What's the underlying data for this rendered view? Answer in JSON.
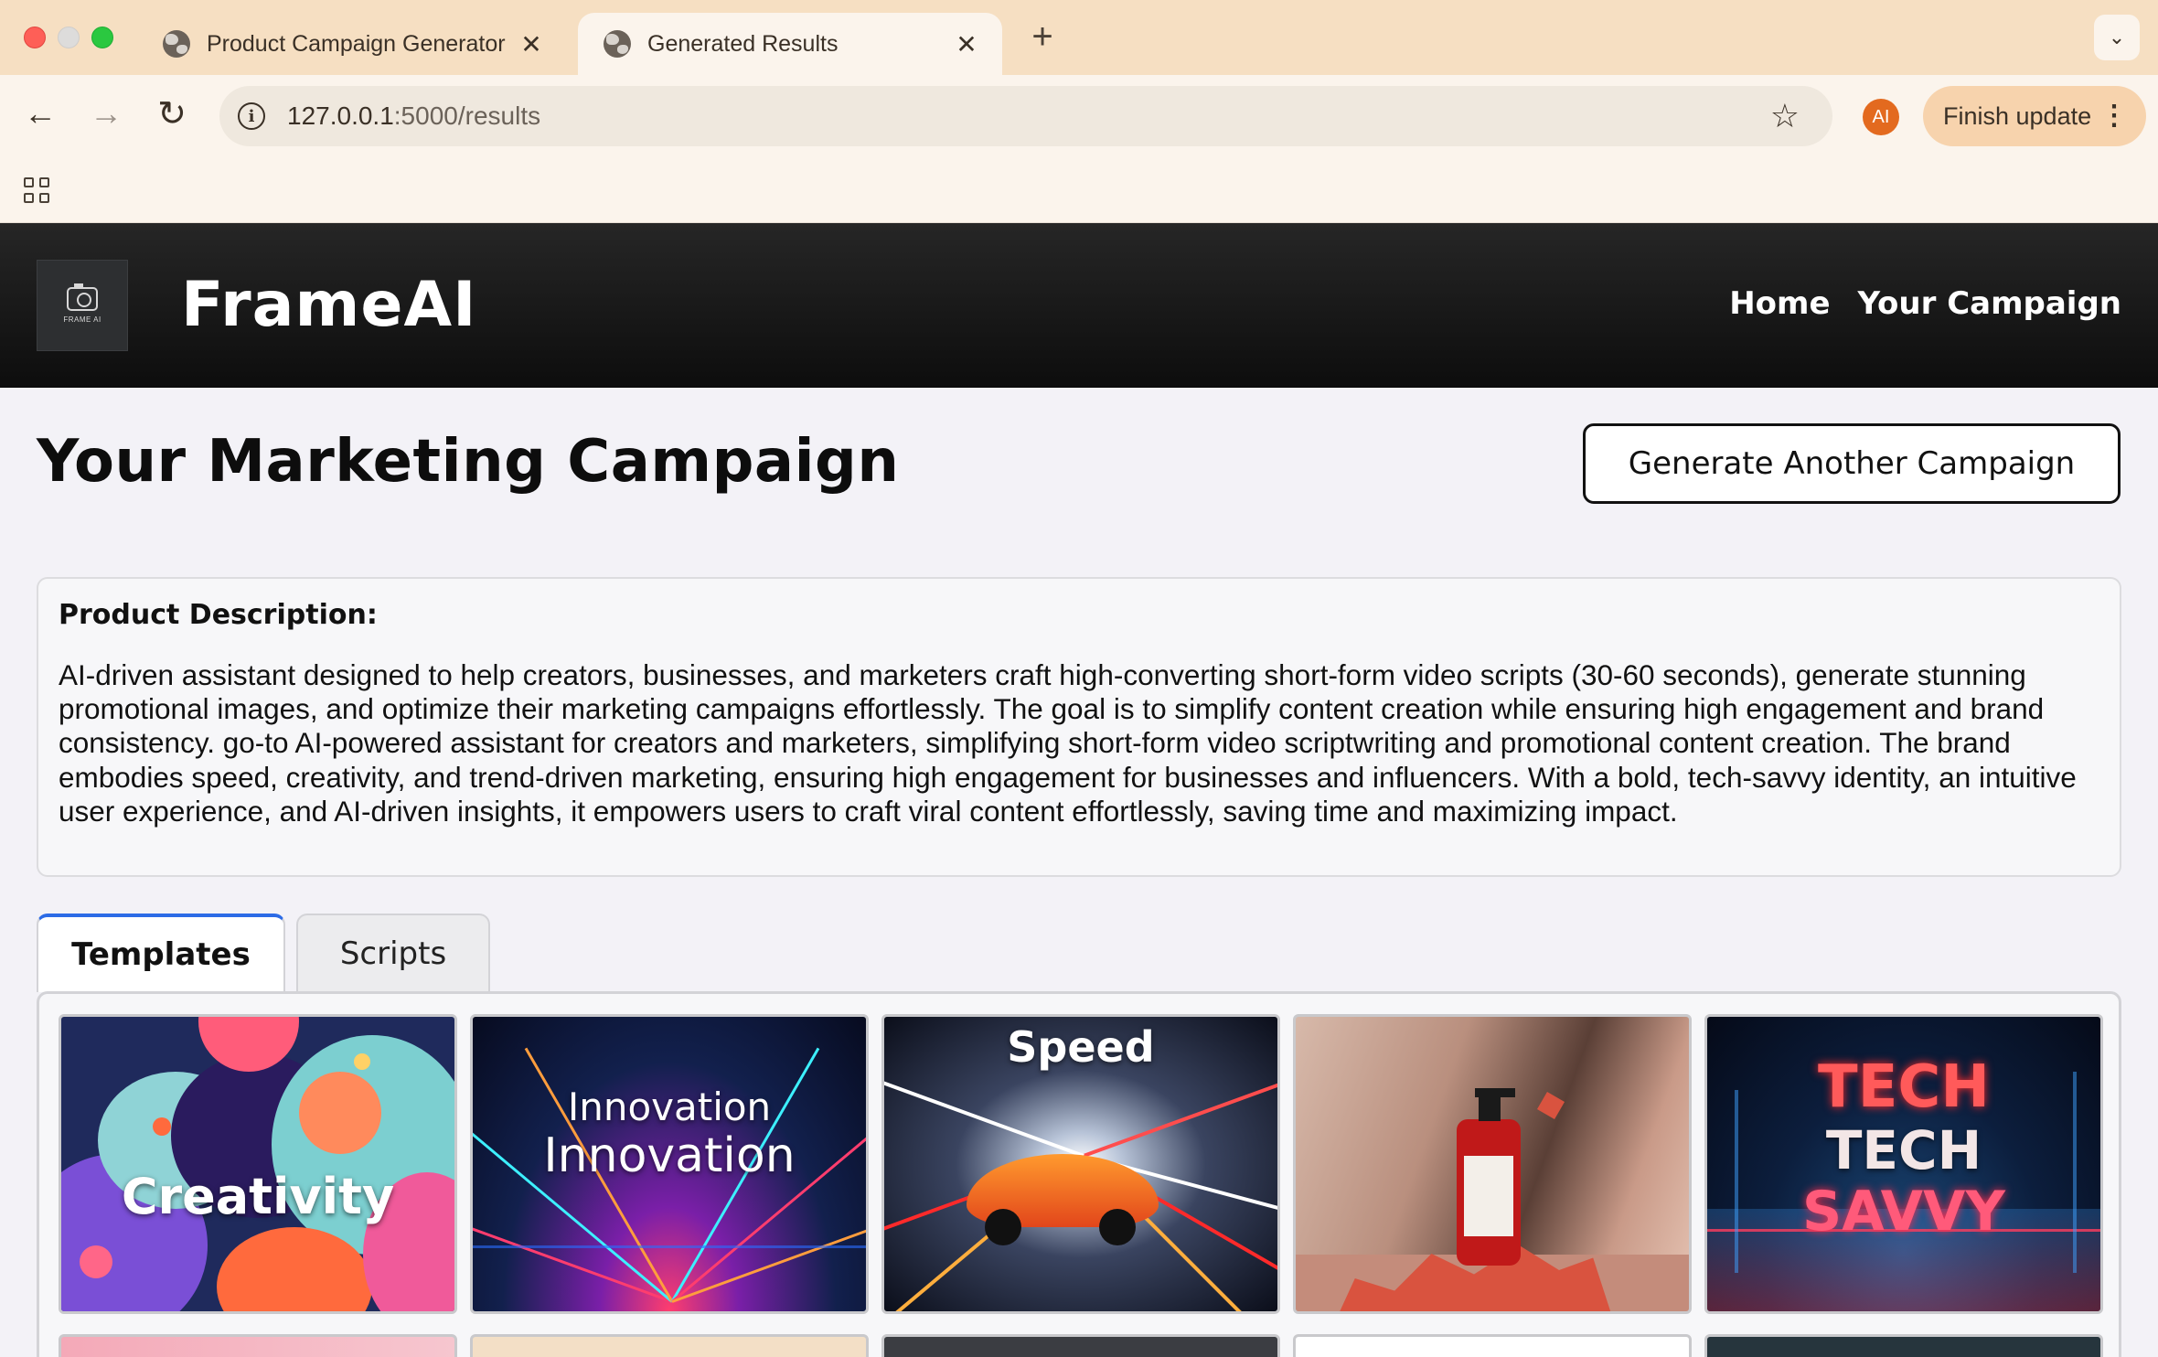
{
  "browser": {
    "tabs": [
      {
        "title": "Product Campaign Generator",
        "active": false
      },
      {
        "title": "Generated Results",
        "active": true
      }
    ],
    "close_glyph": "✕",
    "new_tab_glyph": "+",
    "tab_menu_glyph": "⌄",
    "url_host": "127.0.0.1",
    "url_path": ":5000/results",
    "profile_initials": "AI",
    "finish_update_label": "Finish update",
    "icons": {
      "back": "←",
      "forward": "→",
      "reload": "↻",
      "star": "☆",
      "info": "i",
      "kebab": "⋮"
    }
  },
  "site": {
    "logo_text": "FRAME AI",
    "brand": "FrameAI",
    "nav": [
      "Home",
      "Your Campaign"
    ]
  },
  "page": {
    "title": "Your Marketing Campaign",
    "generate_button": "Generate Another Campaign",
    "description_heading": "Product Description:",
    "description_text": "AI-driven assistant designed to help creators, businesses, and marketers craft high-converting short-form video scripts (30-60 seconds), generate stunning promotional images, and optimize their marketing campaigns effortlessly. The goal is to simplify content creation while ensuring high engagement and brand consistency. go-to AI-powered assistant for creators and marketers, simplifying short-form video scriptwriting and promotional content creation. The brand embodies speed, creativity, and trend-driven marketing, ensuring high engagement for businesses and influencers. With a bold, tech-savvy identity, an intuitive user experience, and AI-driven insights, it empowers users to craft viral content effortlessly, saving time and maximizing impact.",
    "tabs": [
      {
        "label": "Templates",
        "active": true
      },
      {
        "label": "Scripts",
        "active": false
      }
    ],
    "templates": [
      {
        "name": "creativity",
        "text": "Creativity"
      },
      {
        "name": "innovation",
        "text_top": "Innovation",
        "text_bottom": "Innovation"
      },
      {
        "name": "speed",
        "text": "Speed"
      },
      {
        "name": "product-bottle",
        "text": ""
      },
      {
        "name": "tech-savvy",
        "text_1": "TECH",
        "text_2": "TECH",
        "text_3": "SAVVY"
      }
    ]
  },
  "colors": {
    "tabstrip": "#f6dfc2",
    "toolbar": "#fbf4ec",
    "accent_tab": "#2c6be6",
    "profile": "#e36a1f",
    "finish_update": "#f7d3ad",
    "header": "#111111",
    "page_bg": "#f3f2f7"
  }
}
